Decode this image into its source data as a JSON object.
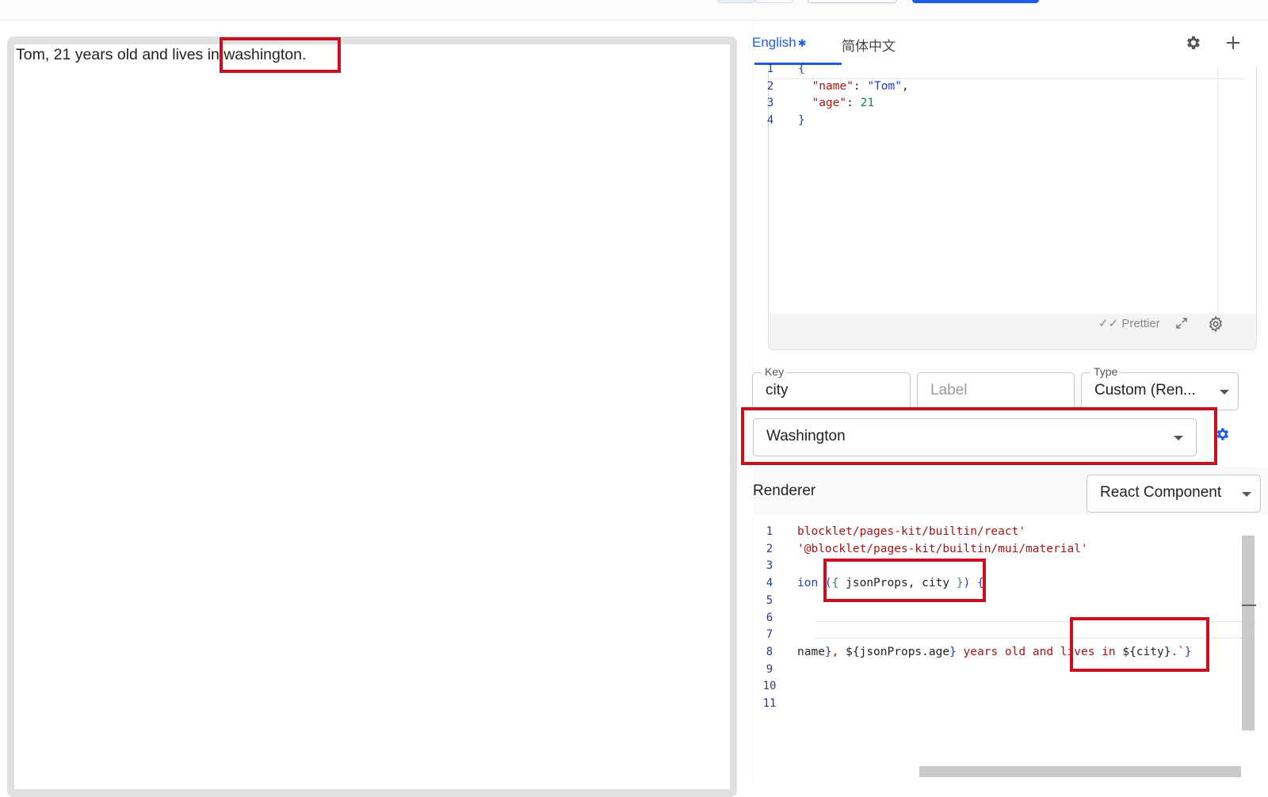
{
  "preview": {
    "text": "Tom, 21 years old and lives in washington."
  },
  "tabs": [
    {
      "label": "English",
      "active": true,
      "modified_marker": "✱"
    },
    {
      "label": "简体中文",
      "active": false
    }
  ],
  "icons": {
    "settings": "gear-icon",
    "add": "plus-icon",
    "prettier": "double-check-icon",
    "expand": "expand-icon",
    "editor_settings": "gear-outline-icon",
    "field_settings": "gear-icon"
  },
  "json_editor": {
    "line_numbers": [
      "1",
      "2",
      "3",
      "4"
    ],
    "lines": [
      [
        {
          "t": "{",
          "c": "#1e40c8"
        }
      ],
      [
        {
          "t": "  ",
          "c": "#222"
        },
        {
          "t": "\"name\"",
          "c": "#a31515"
        },
        {
          "t": ": ",
          "c": "#222"
        },
        {
          "t": "\"Tom\"",
          "c": "#1e40c8"
        },
        {
          "t": ",",
          "c": "#222"
        }
      ],
      [
        {
          "t": "  ",
          "c": "#222"
        },
        {
          "t": "\"age\"",
          "c": "#a31515"
        },
        {
          "t": ": ",
          "c": "#222"
        },
        {
          "t": "21",
          "c": "#098658"
        }
      ],
      [
        {
          "t": "}",
          "c": "#1e40c8"
        }
      ]
    ],
    "prettier_label": "Prettier"
  },
  "fields": {
    "key": {
      "label": "Key",
      "value": "city"
    },
    "label": {
      "placeholder": "Label"
    },
    "type": {
      "label": "Type",
      "value": "Custom (Ren..."
    },
    "value_select": {
      "value": "Washington"
    }
  },
  "renderer": {
    "label": "Renderer",
    "select_value": "React Component"
  },
  "code_editor": {
    "line_numbers": [
      "1",
      "2",
      "3",
      "4",
      "5",
      "6",
      "7",
      "8",
      "9",
      "10",
      "11"
    ],
    "lines": [
      [
        {
          "t": "blocklet/pages-kit/builtin/react'",
          "c": "#a31515"
        }
      ],
      [
        {
          "t": "'@blocklet/pages-kit/builtin/mui/material'",
          "c": "#a31515"
        }
      ],
      [],
      [
        {
          "t": "ion ",
          "c": "#1e40c8"
        },
        {
          "t": "(",
          "c": "#1e40c8"
        },
        {
          "t": "{ ",
          "c": "#2e8b57"
        },
        {
          "t": "jsonProps, city ",
          "c": "#222"
        },
        {
          "t": "}",
          "c": "#2e8b57"
        },
        {
          "t": ") {",
          "c": "#1e40c8"
        }
      ],
      [],
      [],
      [],
      [
        {
          "t": "name",
          "c": "#222"
        },
        {
          "t": "}",
          "c": "#1e40c8"
        },
        {
          "t": ", ",
          "c": "#a31515"
        },
        {
          "t": "${",
          "c": "#222"
        },
        {
          "t": "jsonProps.age",
          "c": "#222"
        },
        {
          "t": "}",
          "c": "#1e40c8"
        },
        {
          "t": " years old and lives in ",
          "c": "#a31515"
        },
        {
          "t": "${city}",
          "c": "#222"
        },
        {
          "t": ".`",
          "c": "#a31515"
        },
        {
          "t": "}",
          "c": "#1e40c8"
        }
      ],
      [],
      [],
      []
    ]
  }
}
